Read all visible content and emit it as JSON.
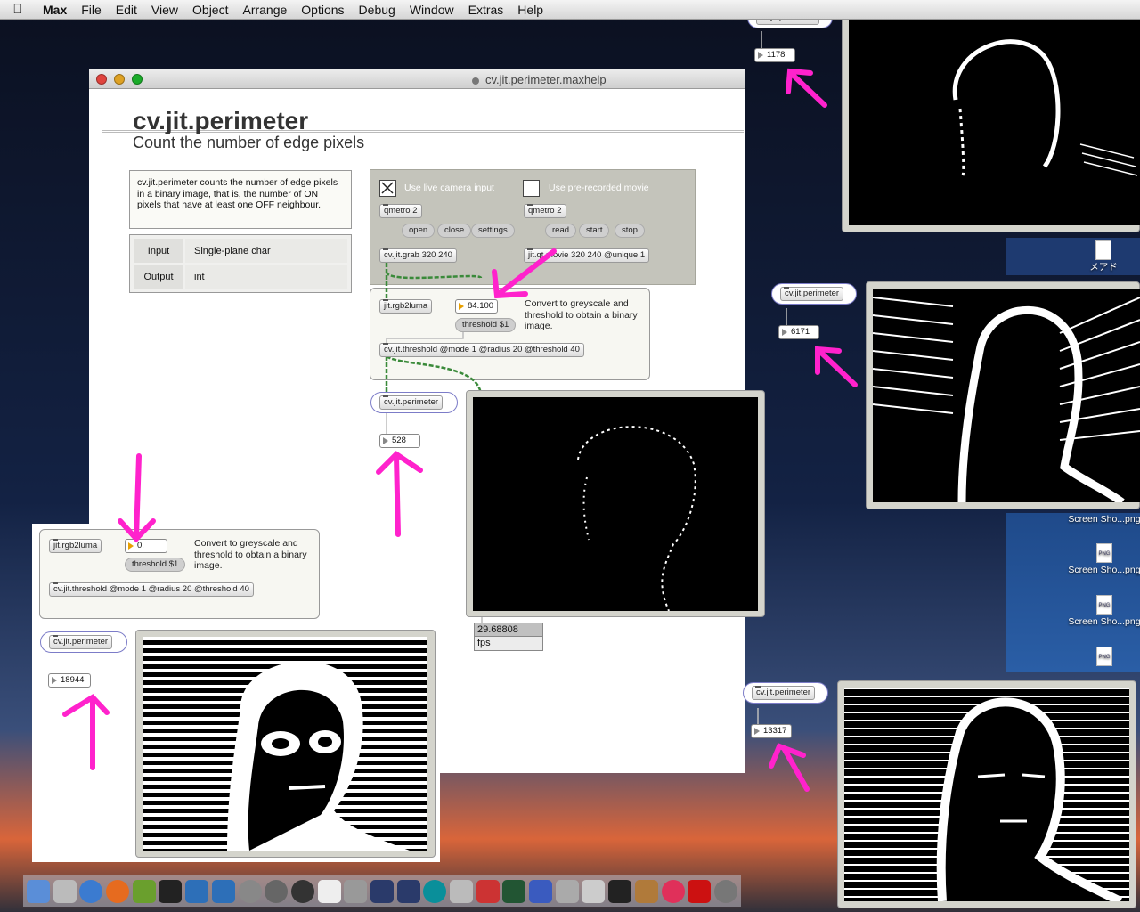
{
  "menubar": {
    "apple": "",
    "items": [
      "Max",
      "File",
      "Edit",
      "View",
      "Object",
      "Arrange",
      "Options",
      "Debug",
      "Window",
      "Extras",
      "Help"
    ]
  },
  "window": {
    "title": "cv.jit.perimeter.maxhelp"
  },
  "help": {
    "title": "cv.jit.perimeter",
    "subtitle": "Count the number of edge pixels",
    "description": "cv.jit.perimeter counts the number of edge pixels in a binary image, that is, the number of ON pixels that have at least one OFF neighbour.",
    "io": [
      {
        "k": "Input",
        "v": "Single-plane char"
      },
      {
        "k": "Output",
        "v": "int"
      }
    ]
  },
  "patch": {
    "live_camera_label": "Use live camera input",
    "movie_label": "Use pre-recorded movie",
    "qmetro": "qmetro 2",
    "open": "open",
    "close": "close",
    "settings": "settings",
    "read": "read",
    "start": "start",
    "stop": "stop",
    "grab": "cv.jit.grab 320 240",
    "movie": "jit.qt.movie 320 240 @unique 1",
    "rgb2luma": "jit.rgb2luma",
    "threshold_value": "84.100",
    "threshold_msg": "threshold $1",
    "convert_note": "Convert to greyscale and threshold to obtain a binary image.",
    "thresh_obj": "cv.jit.threshold @mode 1 @radius 20 @threshold 40",
    "perimeter": "cv.jit.perimeter",
    "perimeter_out": "528",
    "fps_value": "29.68808",
    "fps_label": "fps"
  },
  "patch2": {
    "rgb2luma": "jit.rgb2luma",
    "threshold_value": "0.",
    "threshold_msg": "threshold $1",
    "convert_note": "Convert to greyscale and threshold to obtain a binary image.",
    "thresh_obj": "cv.jit.threshold @mode 1 @radius 20 @threshold 40",
    "perimeter": "cv.jit.perimeter",
    "perimeter_out": "18944"
  },
  "right": {
    "perimeter": "cv.jit.perimeter",
    "out1": "1178",
    "out2": "6171",
    "out3": "13317"
  },
  "desktop": {
    "icons": [
      {
        "label": "メアド"
      },
      {
        "label": "Screen Sho...png"
      },
      {
        "label": "Screen Sho...png"
      },
      {
        "label": "Screen Sho...png"
      },
      {
        "label": "Screen Sho...png"
      }
    ],
    "png_tag": "PNG"
  },
  "colors": {
    "arrow": "#ff22cc",
    "patchcord": "#3a8a3a",
    "perimeter_border": "#7c7cc8"
  },
  "dock": {
    "apps": [
      "finder-icon",
      "preview-icon",
      "mail-icon",
      "firefox-icon",
      "bbedit-icon",
      "terminal-icon",
      "vnc-icon",
      "vnc2-icon",
      "chronosync-icon",
      "activity-icon",
      "five-icon",
      "pd-icon",
      "max-icon",
      "pd-l2ork-icon",
      "pd-extended-icon",
      "arduino-icon",
      "xcode-icon",
      "tools-icon",
      "oscilloscope-icon",
      "dictionary-icon",
      "preview2-icon",
      "scissors-icon",
      "piano-icon",
      "guitar-icon",
      "itunes-icon",
      "flash-icon",
      "audio-icon"
    ]
  }
}
